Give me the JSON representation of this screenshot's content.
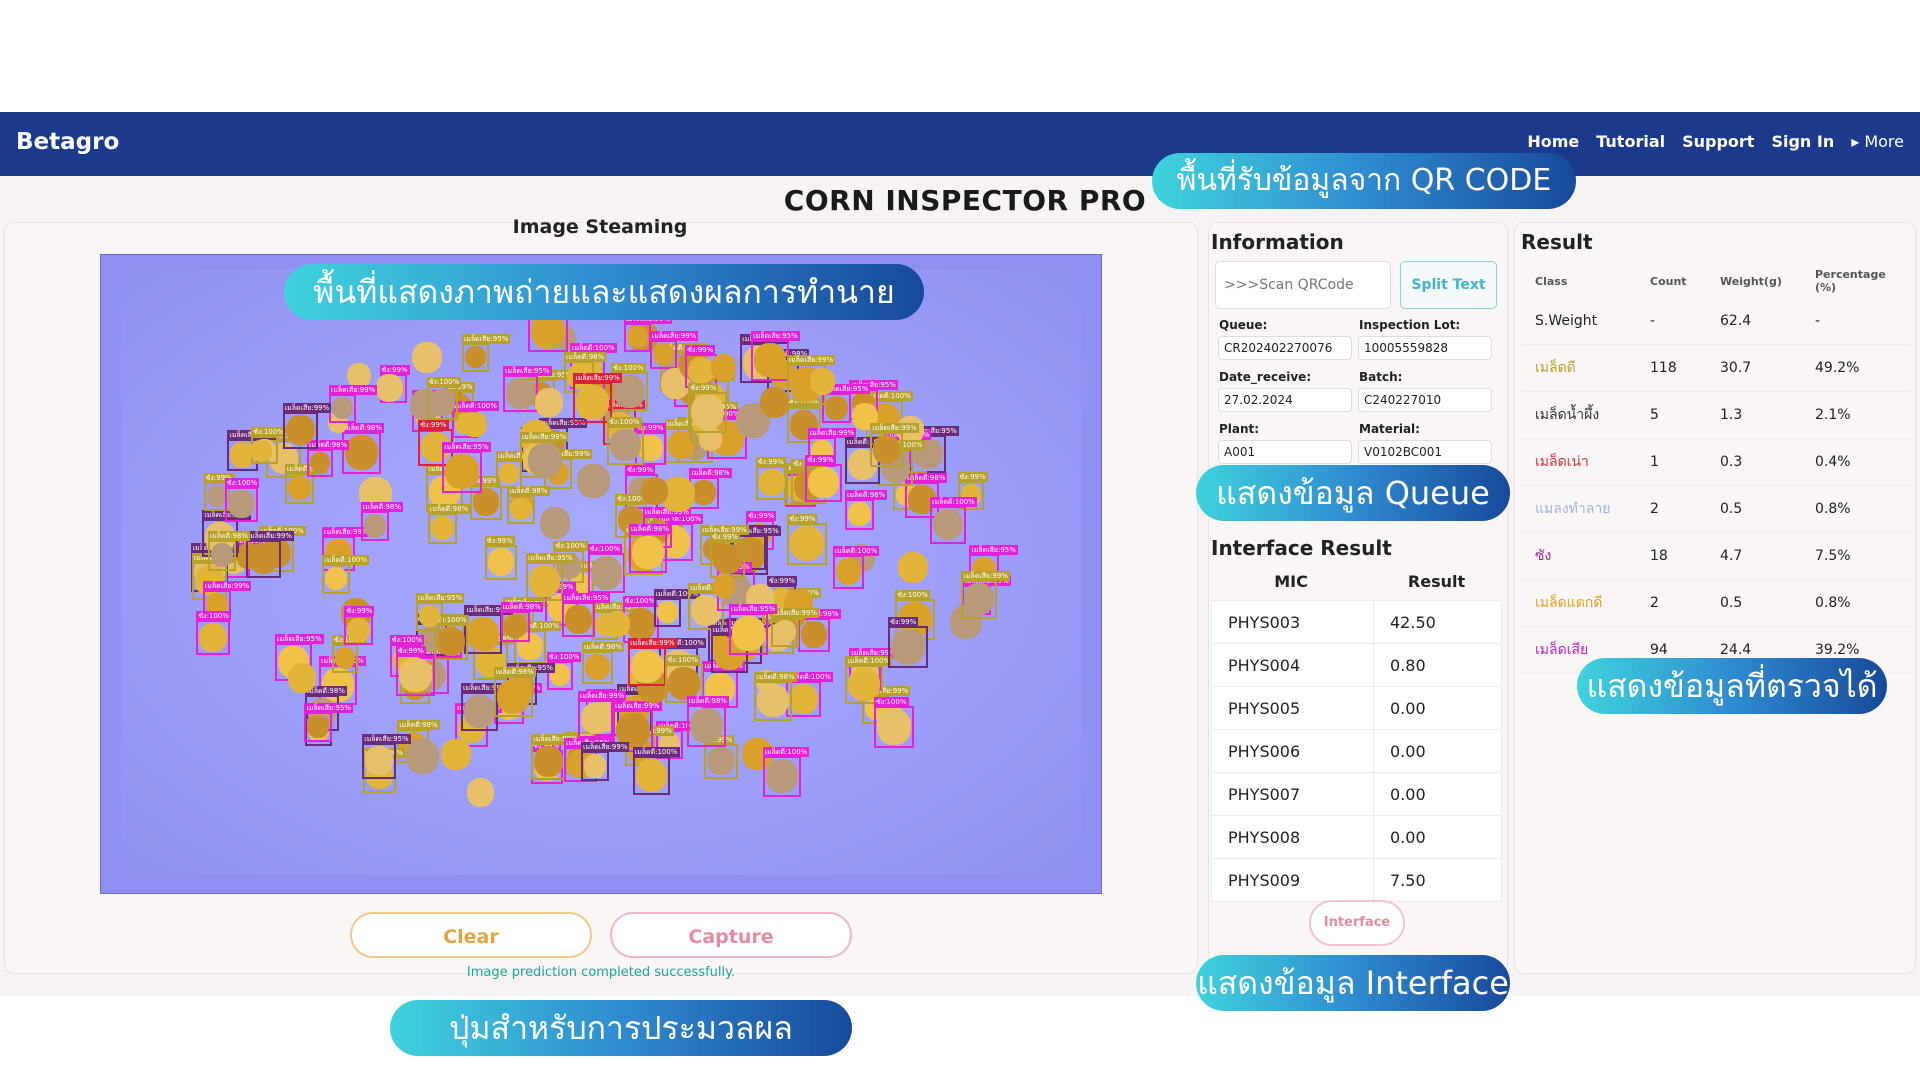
{
  "nav": {
    "brand": "Betagro",
    "links": [
      "Home",
      "Tutorial",
      "Support",
      "Sign In"
    ],
    "more": "▸ More"
  },
  "page_title": "CORN INSPECTOR PRO",
  "stream": {
    "title": "Image Steaming",
    "clear_label": "Clear",
    "capture_label": "Capture",
    "status": "Image prediction completed successfully."
  },
  "info": {
    "title": "Information",
    "qr_placeholder": ">>>Scan QRCode",
    "split_label": "Split Text",
    "fields": [
      {
        "label": "Queue:",
        "value": "CR202402270076"
      },
      {
        "label": "Inspection Lot:",
        "value": "10005559828"
      },
      {
        "label": "Date_receive:",
        "value": "27.02.2024"
      },
      {
        "label": "Batch:",
        "value": "C240227010"
      },
      {
        "label": "Plant:",
        "value": "A001"
      },
      {
        "label": "Material:",
        "value": "V0102BC001"
      }
    ]
  },
  "interface": {
    "title": "Interface Result",
    "col_mic": "MIC",
    "col_result": "Result",
    "rows": [
      {
        "mic": "PHYS003",
        "result": "42.50"
      },
      {
        "mic": "PHYS004",
        "result": "0.80"
      },
      {
        "mic": "PHYS005",
        "result": "0.00"
      },
      {
        "mic": "PHYS006",
        "result": "0.00"
      },
      {
        "mic": "PHYS007",
        "result": "0.00"
      },
      {
        "mic": "PHYS008",
        "result": "0.00"
      },
      {
        "mic": "PHYS009",
        "result": "7.50"
      }
    ],
    "button_label": "Interface"
  },
  "result": {
    "title": "Result",
    "columns": [
      "Class",
      "Count",
      "Weight(g)",
      "Percentage (%)"
    ],
    "rows": [
      {
        "class": "S.Weight",
        "count": "-",
        "weight": "62.4",
        "pct": "-",
        "color": "#222222"
      },
      {
        "class": "เมล็ดดี",
        "count": "118",
        "weight": "30.7",
        "pct": "49.2%",
        "color": "#b5a12e"
      },
      {
        "class": "เมล็ดน้ำผึ้ง",
        "count": "5",
        "weight": "1.3",
        "pct": "2.1%",
        "color": "#333333"
      },
      {
        "class": "เมล็ดเน่า",
        "count": "1",
        "weight": "0.3",
        "pct": "0.4%",
        "color": "#e0303a"
      },
      {
        "class": "แมลงทำลาย",
        "count": "2",
        "weight": "0.5",
        "pct": "0.8%",
        "color": "#9db5de"
      },
      {
        "class": "ซัง",
        "count": "18",
        "weight": "4.7",
        "pct": "7.5%",
        "color": "#9a2aa6"
      },
      {
        "class": "เมล็ดแตกดี",
        "count": "2",
        "weight": "0.5",
        "pct": "0.8%",
        "color": "#e4a020"
      },
      {
        "class": "เมล็ดเสีย",
        "count": "94",
        "weight": "24.4",
        "pct": "39.2%",
        "color": "#c023c4"
      }
    ]
  },
  "callouts": {
    "qr": "พื้นที่รับข้อมูลจาก QR CODE",
    "image": "พื้นที่แสดงภาพถ่ายและแสดงผลการทำนาย",
    "queue": "แสดงข้อมูล Queue",
    "detected": "แสดงข้อมูลที่ตรวจได้",
    "interface": "แสดงข้อมูล Interface",
    "buttons": "ปุ่มสำหรับการประมวลผล"
  },
  "detection_labels": [
    "เมล็ดดี:100%",
    "เมล็ดเสีย:99%",
    "ซัง:100%",
    "เมล็ดดี:98%",
    "เมล็ดเสีย:95%",
    "ซัง:99%"
  ],
  "colors": {
    "navbar": "#1c3a8c",
    "good_box": "#b8a12a",
    "bad_box": "#e321d8",
    "cob_box": "#6a2b7a",
    "rotten_box": "#e0203a"
  }
}
